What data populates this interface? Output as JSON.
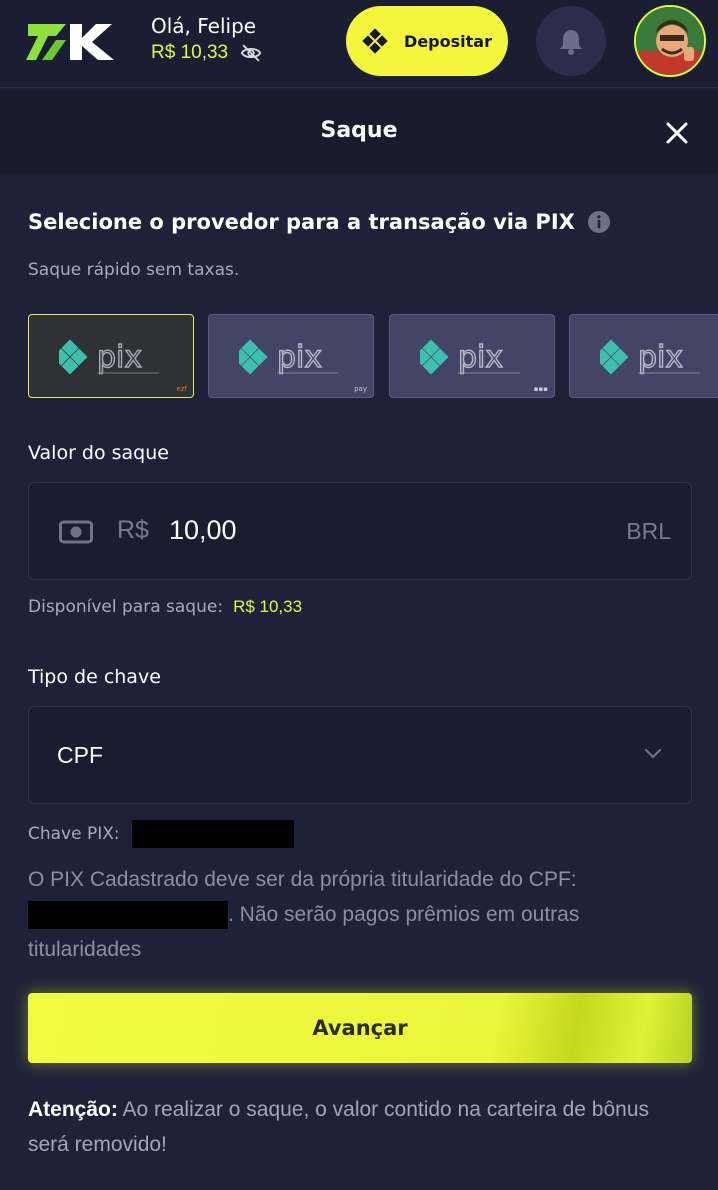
{
  "header": {
    "logo_text": "7K",
    "greeting": "Olá, Felipe",
    "balance": "R$ 10,33",
    "deposit_label": "Depositar"
  },
  "modal": {
    "title": "Saque"
  },
  "provider_section": {
    "title": "Selecione o provedor para a transação via PIX",
    "subtitle": "Saque rápido sem taxas.",
    "providers": [
      {
        "name": "pix",
        "selected": true
      },
      {
        "name": "pix",
        "selected": false
      },
      {
        "name": "pix",
        "selected": false
      },
      {
        "name": "pix",
        "selected": false
      }
    ]
  },
  "amount": {
    "label": "Valor do saque",
    "currency_symbol": "R$",
    "value": "10,00",
    "currency_code": "BRL",
    "available_label": "Disponível para saque:",
    "available_value": "R$ 10,33"
  },
  "key_type": {
    "label": "Tipo de chave",
    "value": "CPF",
    "chave_label": "Chave PIX:"
  },
  "notice": {
    "before": "O PIX Cadastrado deve ser da própria titularidade do CPF:",
    "after": ". Não serão pagos prêmios em outras titularidades"
  },
  "advance_label": "Avançar",
  "warning": {
    "strong": "Atenção:",
    "text": " Ao realizar o saque, o valor contido na carteira de bônus será removido!"
  },
  "colors": {
    "accent": "#d7ff3c",
    "button": "#f3f73c",
    "background": "#1f2138"
  }
}
